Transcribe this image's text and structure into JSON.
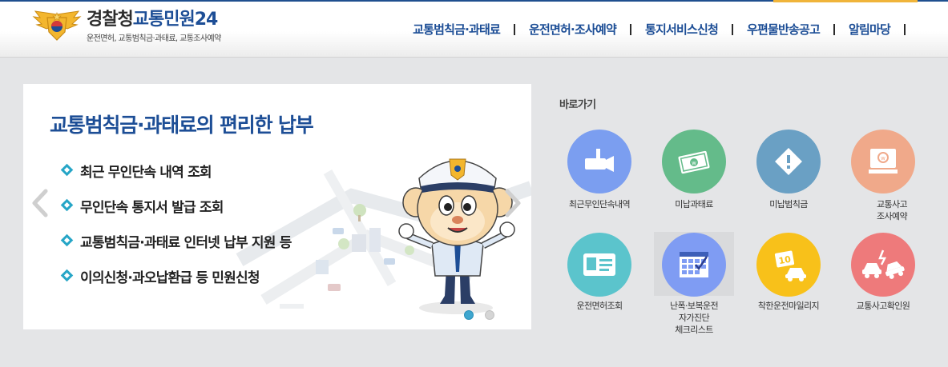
{
  "header": {
    "logo_main": "경찰청",
    "logo_accent": "교통민원24",
    "logo_subtitle": "운전면허, 교통범칙금·과태료, 교통조사예약",
    "nav": [
      {
        "label": "교통범칙금·과태료"
      },
      {
        "label": "운전면허·조사예약"
      },
      {
        "label": "통지서비스신청"
      },
      {
        "label": "우편물반송공고"
      },
      {
        "label": "알림마당"
      }
    ]
  },
  "banner": {
    "title": "교통범칙금·과태료의 편리한 납부",
    "items": [
      {
        "text": "최근 무인단속 내역 조회"
      },
      {
        "text": "무인단속 통지서 발급 조회"
      },
      {
        "text": "교통범칙금·과태료 인터넷 납부 지원 등"
      },
      {
        "text": "이의신청·과오납환급 등 민원신청"
      }
    ],
    "active_slide": 1,
    "slide_count": 2
  },
  "quicklinks": {
    "title": "바로가기",
    "items": [
      {
        "label": "최근무인단속내역",
        "icon": "camera-icon",
        "color": "#7b9ef0"
      },
      {
        "label": "미납과태료",
        "icon": "money-icon",
        "color": "#64bb8a"
      },
      {
        "label": "미납범칙금",
        "icon": "warning-diamond-icon",
        "color": "#6aa0c4"
      },
      {
        "label": "교통사고\n조사예약",
        "icon": "monitor-icon",
        "color": "#f0a98a"
      },
      {
        "label": "운전면허조회",
        "icon": "license-card-icon",
        "color": "#5bc4cc"
      },
      {
        "label": "난폭·보복운전\n자가진단\n체크리스트",
        "icon": "calendar-check-icon",
        "color": "#7f9cf3"
      },
      {
        "label": "착한운전마일리지",
        "icon": "mileage-car-icon",
        "color": "#f8c11a"
      },
      {
        "label": "교통사고확인원",
        "icon": "car-crash-icon",
        "color": "#ee7a7b"
      }
    ]
  }
}
